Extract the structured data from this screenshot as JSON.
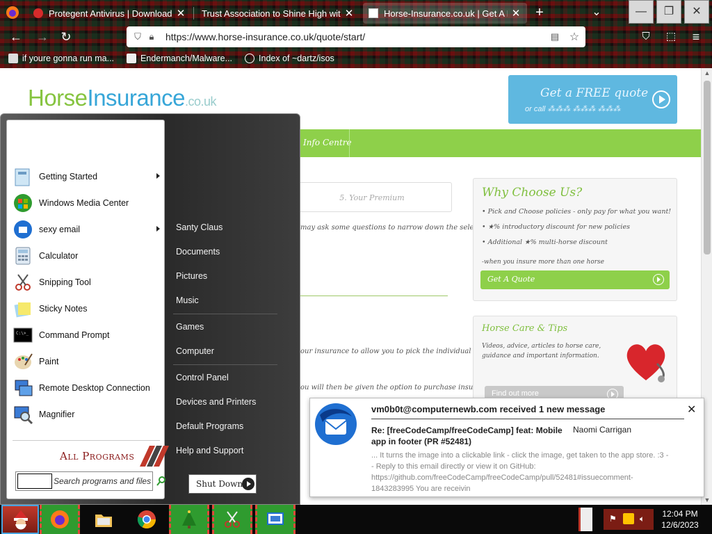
{
  "browser": {
    "tabs": [
      {
        "title": "Protegent Antivirus | Download Fr",
        "active": false
      },
      {
        "title": "Trust Association to Shine High with U",
        "active": false
      },
      {
        "title": "Horse-Insurance.co.uk | Get A Free",
        "active": true
      }
    ],
    "new_tab": "+",
    "tab_list": "⌄",
    "url": "https://www.horse-insurance.co.uk/quote/start/",
    "bookmarks": [
      "if youre gonna run ma...",
      "Endermanch/Malware...",
      "Index of ~dartz/isos"
    ]
  },
  "page": {
    "logo_horse": "Horse",
    "logo_insurance": "Insurance",
    "logo_tld": ".co.uk",
    "quote_banner_title": "Get a FREE quote",
    "quote_banner_sub": "or call ⁂⁂⁂ ⁂⁂⁂ ⁂⁂⁂",
    "nav_item": "Info Centre",
    "your_premium": "5. Your Premium",
    "body_line_1": "may ask some questions to narrow down the selection of products",
    "body_line_2": "our insurance to allow you to pick the individual elements you",
    "body_line_3": "ou will then be given the option to purchase insurance or save",
    "why_title": "Why Choose Us?",
    "why_items": [
      "Pick and Choose policies - only pay for what you want!",
      "★% introductory discount for new policies",
      "Additional ★% multi-horse discount"
    ],
    "why_note": "-when you insure more than one horse",
    "get_quote": "Get A Quote",
    "care_title": "Horse Care & Tips",
    "care_text": "Videos, advice, articles to horse care, guidance and important information.",
    "find_out_more": "Find out more"
  },
  "start_menu": {
    "programs": [
      {
        "label": "Getting Started",
        "submenu": true,
        "icon": "getting-started-icon"
      },
      {
        "label": "Windows Media Center",
        "submenu": false,
        "icon": "media-center-icon"
      },
      {
        "label": "sexy email",
        "submenu": true,
        "icon": "thunderbird-icon"
      },
      {
        "label": "Calculator",
        "submenu": false,
        "icon": "calculator-icon"
      },
      {
        "label": "Snipping Tool",
        "submenu": false,
        "icon": "scissors-icon"
      },
      {
        "label": "Sticky Notes",
        "submenu": false,
        "icon": "sticky-notes-icon"
      },
      {
        "label": "Command Prompt",
        "submenu": false,
        "icon": "terminal-icon"
      },
      {
        "label": "Paint",
        "submenu": false,
        "icon": "palette-icon"
      },
      {
        "label": "Remote Desktop Connection",
        "submenu": false,
        "icon": "remote-desktop-icon"
      },
      {
        "label": "Magnifier",
        "submenu": false,
        "icon": "magnifier-icon"
      }
    ],
    "all_programs": "All Programs",
    "search_placeholder": "Search programs and files",
    "right_items": [
      "Santy Claus",
      "Documents",
      "Pictures",
      "Music",
      "Games",
      "Computer",
      "Control Panel",
      "Devices and Printers",
      "Default Programs",
      "Help and Support"
    ],
    "shutdown": "Shut Down"
  },
  "notification": {
    "title": "vm0b0t@computernewb.com received 1 new message",
    "subject": "Re: [freeCodeCamp/freeCodeCamp] feat: Mobile app in footer (PR #52481)",
    "sender": "Naomi Carrigan",
    "body": "... It turns the image into a clickable link - click the image, get taken to the app store. :3 -- Reply to this email directly or view it on GitHub: https://github.com/freeCodeCamp/freeCodeCamp/pull/52481#issuecomment-1843283995 You are receivin",
    "close": "✕"
  },
  "taskbar": {
    "time": "12:04 PM",
    "date": "12/6/2023"
  },
  "colors": {
    "brand_green": "#8ed04a",
    "brand_blue": "#37a6d8",
    "taskbar_button": "#2f9b2f"
  }
}
